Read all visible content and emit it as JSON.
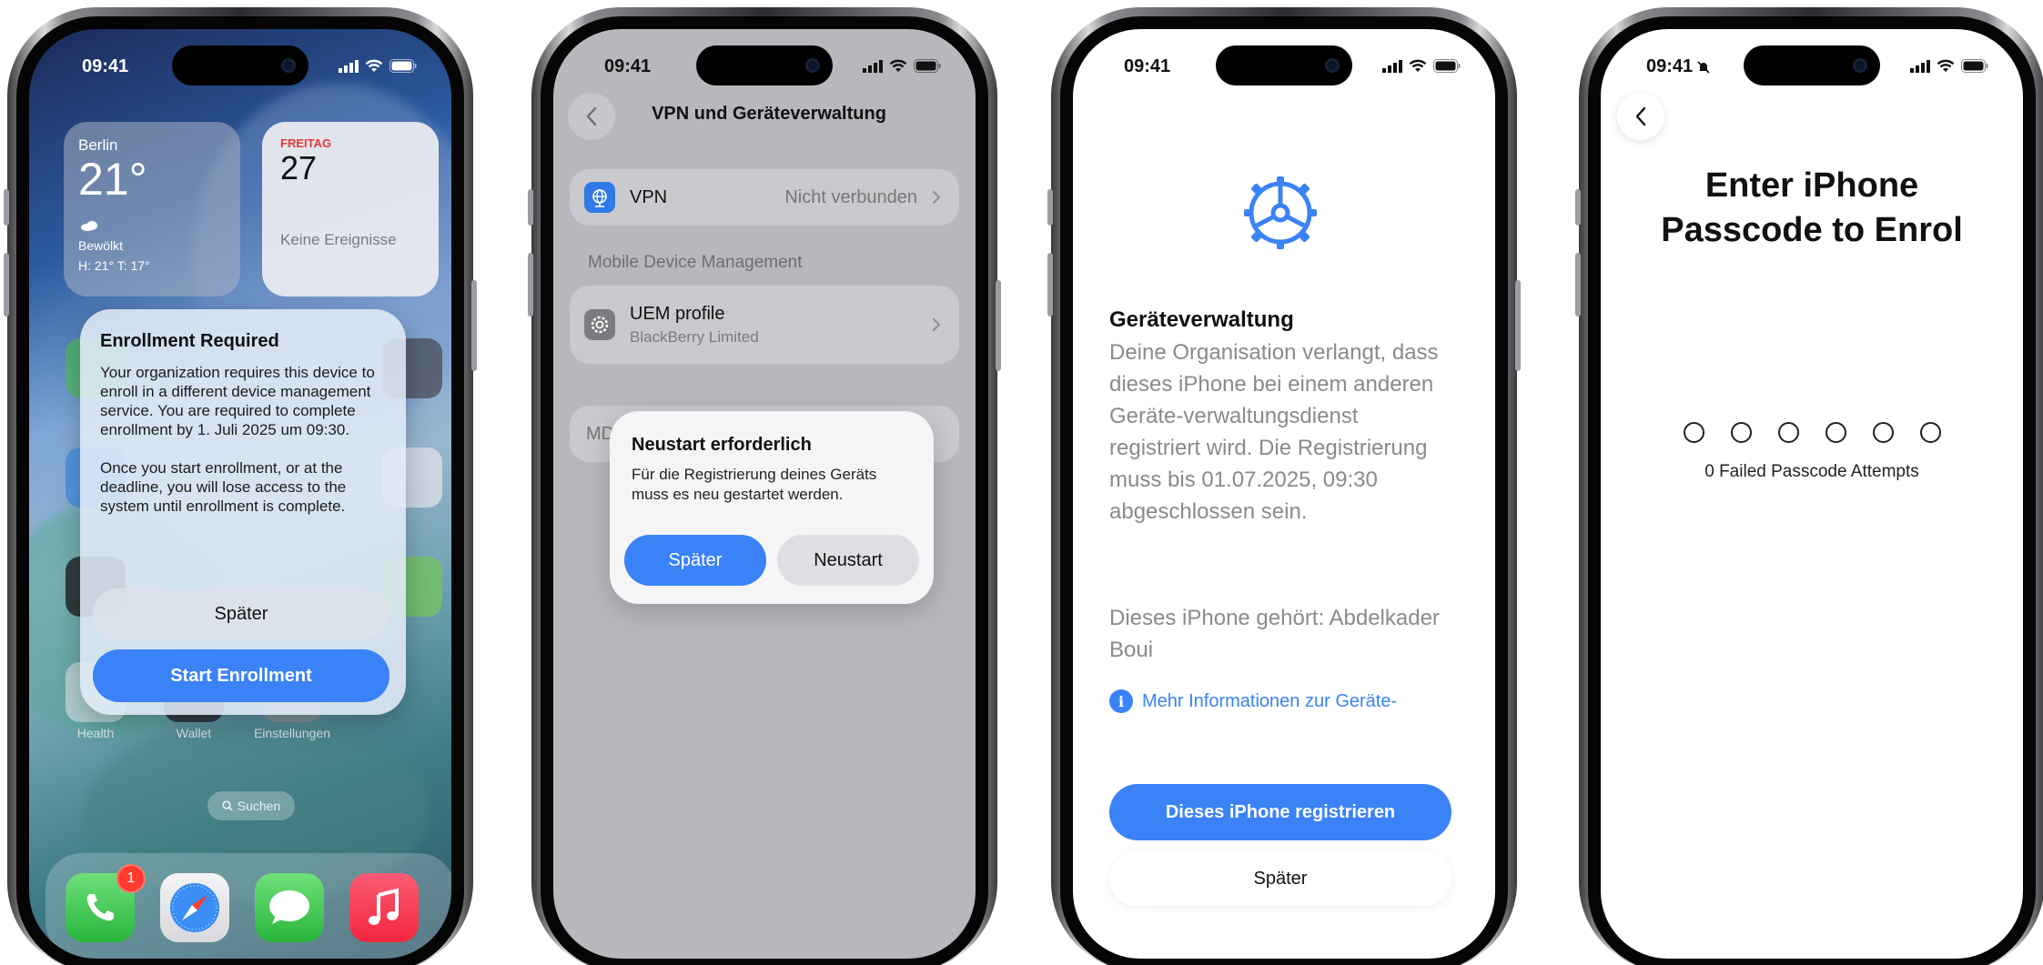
{
  "colors": {
    "accent": "#3a82f6",
    "badge": "#ff3b30",
    "calendar_day": "#e53935"
  },
  "phone1": {
    "status_time": "09:41",
    "weather": {
      "city": "Berlin",
      "temperature": "21°",
      "condition": "Bewölkt",
      "high_low": "H: 21° T: 17°"
    },
    "calendar": {
      "day": "FREITAG",
      "date": "27",
      "events": "Keine Ereignisse"
    },
    "alert": {
      "title": "Enrollment Required",
      "message1": "Your organization requires this device to enroll in a different device management service. You are required to complete enrollment by 1. Juli 2025 um 09:30.",
      "message2": "Once you start enrollment, or at the deadline, you will lose access to the system until enrollment is complete.",
      "later_label": "Später",
      "start_label": "Start Enrollment"
    },
    "app_labels": [
      "Health",
      "Wallet",
      "Einstellungen"
    ],
    "search_label": "Suchen",
    "dock": [
      {
        "icon": "phone-icon",
        "badge": "1"
      },
      {
        "icon": "safari-icon"
      },
      {
        "icon": "messages-icon"
      },
      {
        "icon": "music-icon"
      }
    ]
  },
  "phone2": {
    "status_time": "09:41",
    "nav_title": "VPN und Geräteverwaltung",
    "vpn": {
      "label": "VPN",
      "value": "Nicht verbunden"
    },
    "section_header": "Mobile Device Management",
    "profile": {
      "title": "UEM profile",
      "subtitle": "BlackBerry Limited"
    },
    "hidden_row_text": "MD",
    "alert": {
      "title": "Neustart erforderlich",
      "message": "Für die Registrierung deines Geräts muss es neu gestartet werden.",
      "later_label": "Später",
      "restart_label": "Neustart"
    }
  },
  "phone3": {
    "status_time": "09:41",
    "title": "Geräteverwaltung",
    "body": "Deine Organisation verlangt, dass dieses iPhone bei einem anderen Geräte-verwaltungsdienst registriert wird. Die Registrierung muss bis 01.07.2025, 09:30 abgeschlossen sein.",
    "owner": "Dieses iPhone gehört: Abdelkader Boui",
    "info_link": "Mehr Informationen zur Geräte-",
    "register_label": "Dieses iPhone registrieren",
    "later_label": "Später"
  },
  "phone4": {
    "status_time": "09:41",
    "title_line1": "Enter iPhone",
    "title_line2": "Passcode to Enrol",
    "passcode_length": 6,
    "failed_attempts": "0 Failed Passcode Attempts"
  }
}
